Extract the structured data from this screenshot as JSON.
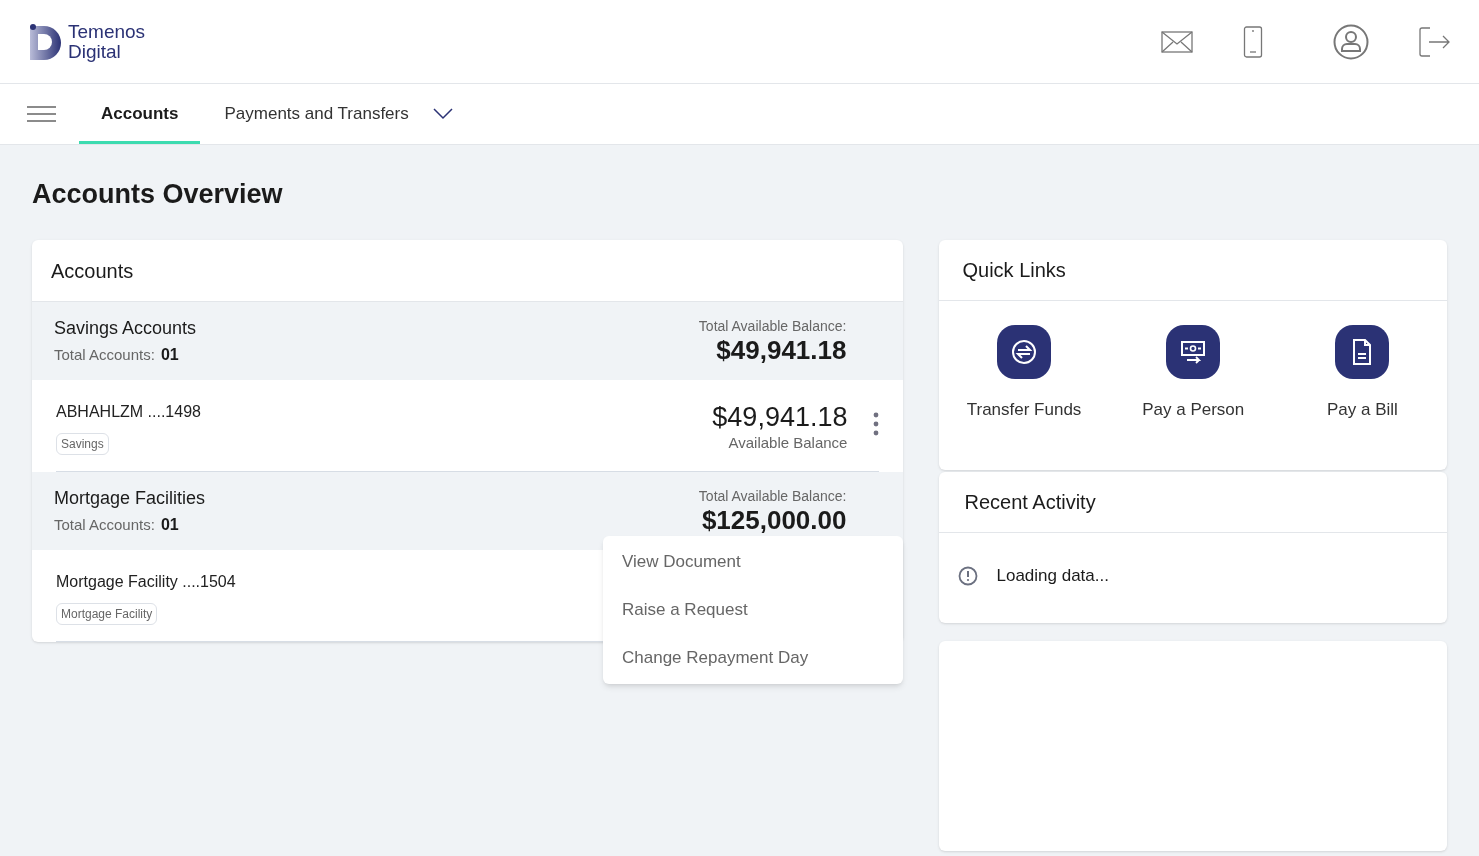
{
  "logo": {
    "line1": "Temenos",
    "line2": "Digital"
  },
  "nav": {
    "tabs": [
      {
        "label": "Accounts",
        "selected": true,
        "dropdown": false
      },
      {
        "label": "Payments and Transfers",
        "selected": false,
        "dropdown": true
      }
    ]
  },
  "page_title": "Accounts Overview",
  "accounts_card": {
    "title": "Accounts",
    "groups": [
      {
        "name": "Savings Accounts",
        "count_label": "Total Accounts:",
        "count": "01",
        "balance_label": "Total Available Balance:",
        "balance": "$49,941.18",
        "accounts": [
          {
            "name": "ABHAHLZM ....1498",
            "tag": "Savings",
            "amount": "$49,941.18",
            "amount_label": "Available Balance",
            "menu": true
          }
        ]
      },
      {
        "name": "Mortgage Facilities",
        "count_label": "Total Accounts:",
        "count": "01",
        "balance_label": "Total Available Balance:",
        "balance": "$125,000.00",
        "accounts": [
          {
            "name": "Mortgage Facility ....1504",
            "tag": "Mortgage Facility",
            "menu": false
          }
        ]
      }
    ]
  },
  "context_menu": {
    "items": [
      "View Document",
      "Raise a Request",
      "Change Repayment Day"
    ]
  },
  "quick_links": {
    "title": "Quick Links",
    "items": [
      {
        "label": "Transfer Funds",
        "kind": "transfer"
      },
      {
        "label": "Pay a Person",
        "kind": "person"
      },
      {
        "label": "Pay a Bill",
        "kind": "bill"
      }
    ]
  },
  "recent_activity": {
    "title": "Recent Activity",
    "message": "Loading data..."
  }
}
